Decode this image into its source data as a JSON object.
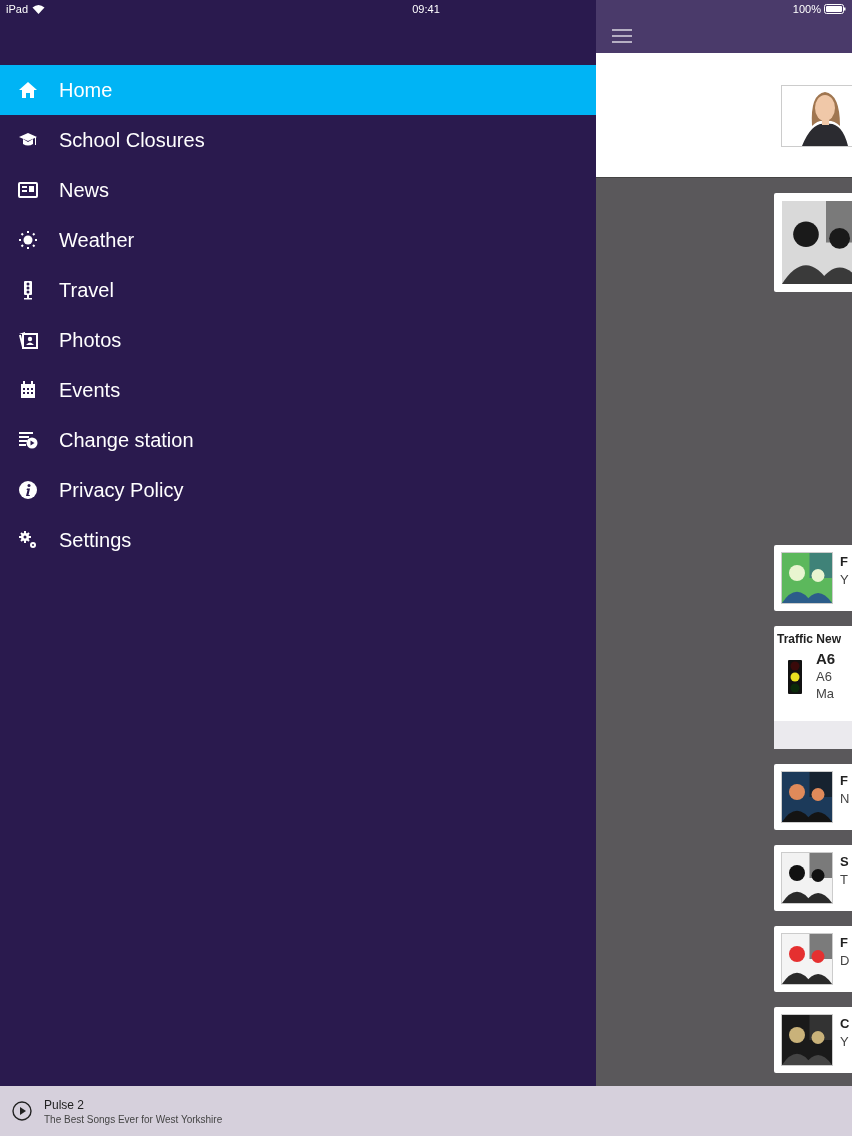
{
  "status_bar": {
    "carrier": "iPad",
    "time": "09:41",
    "battery": "100%"
  },
  "menu": {
    "items": [
      {
        "label": "Home",
        "selected": true
      },
      {
        "label": "School Closures",
        "selected": false
      },
      {
        "label": "News",
        "selected": false
      },
      {
        "label": "Weather",
        "selected": false
      },
      {
        "label": "Travel",
        "selected": false
      },
      {
        "label": "Photos",
        "selected": false
      },
      {
        "label": "Events",
        "selected": false
      },
      {
        "label": "Change station",
        "selected": false
      },
      {
        "label": "Privacy Policy",
        "selected": false
      },
      {
        "label": "Settings",
        "selected": false
      }
    ]
  },
  "content": {
    "cards": [
      {
        "kind": "album"
      },
      {
        "kind": "track",
        "title": "F",
        "subtitle": "Y"
      },
      {
        "kind": "traffic",
        "title": "Traffic New",
        "road": "A6",
        "lines": [
          "A6",
          "Ma"
        ]
      },
      {
        "kind": "track",
        "title": "F",
        "subtitle": "N"
      },
      {
        "kind": "track",
        "title": "S",
        "subtitle": "T"
      },
      {
        "kind": "track",
        "title": "F",
        "subtitle": "D"
      },
      {
        "kind": "track",
        "title": "C",
        "subtitle": "Y"
      }
    ]
  },
  "player": {
    "station": "Pulse 2",
    "tagline": "The Best Songs Ever for West Yorkshire"
  }
}
